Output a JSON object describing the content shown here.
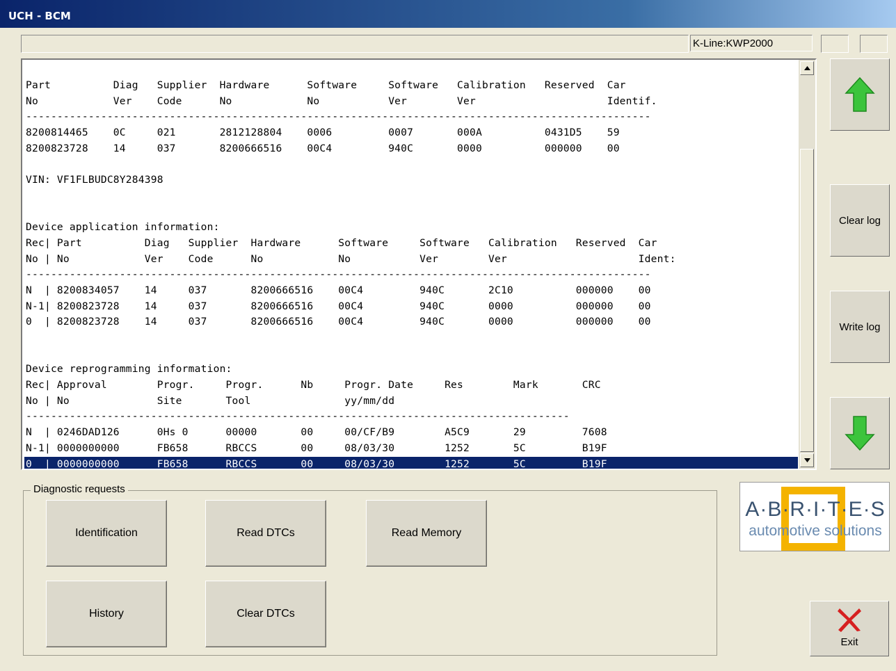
{
  "window": {
    "title": "UCH - BCM"
  },
  "status": {
    "main_text": "",
    "connection": "K-Line:KWP2000"
  },
  "log": {
    "lines": [
      "Part          Diag   Supplier  Hardware      Software     Software   Calibration   Reserved  Car",
      "No            Ver    Code      No            No           Ver        Ver                     Identif.",
      "----------------------------------------------------------------------------------------------------",
      "8200814465    0C     021       2812128804    0006         0007       000A          0431D5    59",
      "8200823728    14     037       8200666516    00C4         940C       0000          000000    00",
      "",
      "VIN: VF1FLBUDC8Y284398",
      "",
      "",
      "Device application information:",
      "Rec| Part          Diag   Supplier  Hardware      Software     Software   Calibration   Reserved  Car",
      "No | No            Ver    Code      No            No           Ver        Ver                     Ident:",
      "----------------------------------------------------------------------------------------------------",
      "N  | 8200834057    14     037       8200666516    00C4         940C       2C10          000000    00",
      "N-1| 8200823728    14     037       8200666516    00C4         940C       0000          000000    00",
      "0  | 8200823728    14     037       8200666516    00C4         940C       0000          000000    00",
      "",
      "",
      "Device reprogramming information:",
      "Rec| Approval        Progr.     Progr.      Nb     Progr. Date     Res        Mark       CRC",
      "No | No              Site       Tool               yy/mm/dd",
      "---------------------------------------------------------------------------------------",
      "N  | 0246DAD126      0Hs 0      00000       00     00/CF/B9        A5C9       29         7608",
      "N-1| 0000000000      FB658      RBCCS       00     08/03/30        1252       5C         B19F",
      "0  | 0000000000      FB658      RBCCS       00     08/03/30        1252       5C         B19F"
    ]
  },
  "side_buttons": {
    "clear_log": "Clear log",
    "write_log": "Write log",
    "up": "arrow-up-icon",
    "down": "arrow-down-icon"
  },
  "diagnostic": {
    "legend": "Diagnostic requests",
    "identification": "Identification",
    "read_dtcs": "Read DTCs",
    "read_memory": "Read Memory",
    "history": "History",
    "clear_dtcs": "Clear DTCs"
  },
  "logo": {
    "name": "A·B·R·I·T·E·S",
    "tagline": "automotive solutions"
  },
  "exit": {
    "label": "Exit",
    "icon": "close-x-icon"
  },
  "colors": {
    "title_bar": "#0a246a",
    "selection": "#0a246a",
    "arrow_green": "#3cc43c",
    "logo_yellow": "#f4b300",
    "exit_red": "#d62020"
  }
}
